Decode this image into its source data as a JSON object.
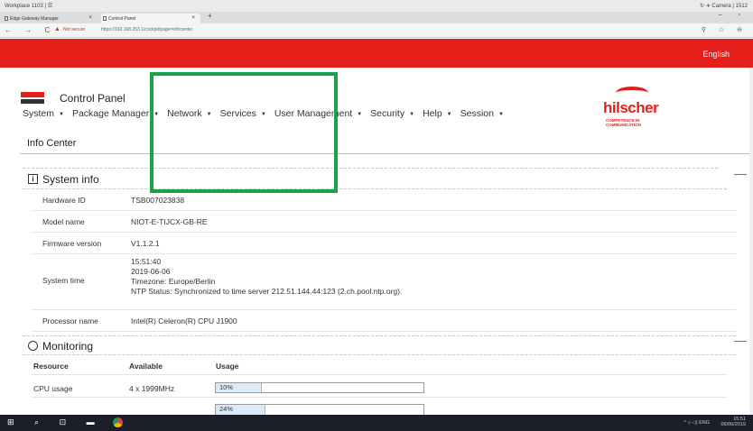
{
  "os": {
    "title_left": "Workplace 1103  |  ☰",
    "title_right": "↻  ∗ Camera  | 1512"
  },
  "browser": {
    "tabs": [
      {
        "label": "Edge Gateway Manager",
        "close": "×"
      },
      {
        "label": "Control Panel",
        "close": "×"
      }
    ],
    "new_tab": "+",
    "window_controls": "–  ▫",
    "nav": "←  →  C",
    "not_secure": "Not secure",
    "url": "https://192.168.253.1/cockpit/page=infocenter",
    "addr_icons": "⚲  ☆  ⊖"
  },
  "banner": {
    "language": "English"
  },
  "header": {
    "logo_text": "hilscher",
    "title": "Control Panel",
    "menu": [
      {
        "label": "System"
      },
      {
        "label": "Package Manager"
      },
      {
        "label": "Network"
      },
      {
        "label": "Services"
      },
      {
        "label": "User Management"
      },
      {
        "label": "Security"
      },
      {
        "label": "Help"
      },
      {
        "label": "Session"
      }
    ],
    "brand_name": "hilscher",
    "brand_tagline": "COMPETENCE IN COMMUNICATION"
  },
  "page": {
    "title": "Info Center"
  },
  "system_info": {
    "title": "System info",
    "icon": "info-icon",
    "rows": {
      "hardware_id": {
        "key": "Hardware ID",
        "value": "TSB007023838"
      },
      "model_name": {
        "key": "Model name",
        "value": "NIOT-E-TIJCX-GB-RE"
      },
      "firmware": {
        "key": "Firmware version",
        "value": "V1.1.2.1"
      },
      "system_time": {
        "key": "System time",
        "time": "15:51:40",
        "date": "2019-06-06",
        "timezone": "Timezone: Europe/Berlin",
        "ntp": "NTP Status: Synchronized to time server 212.51.144.44:123 (2.ch.pool.ntp.org)."
      },
      "processor": {
        "key": "Processor name",
        "value": "Intel(R) Celeron(R) CPU J1900"
      }
    }
  },
  "monitoring": {
    "title": "Monitoring",
    "icon": "clock-icon",
    "columns": [
      "Resource",
      "Available",
      "Usage"
    ],
    "cpu": {
      "resource": "CPU usage",
      "available": "4 x 1999MHz",
      "usage_pct": 10,
      "usage_label": "10%"
    },
    "mem_partial_label": "24%"
  },
  "taskbar": {
    "icons": "⊞ ⌕ ⊡ ▬ ▣",
    "tray_status": "^ ⌂ ◁) ENG",
    "time": "15:51",
    "date": "06/06/2019"
  },
  "colors": {
    "brand_red": "#e5201a",
    "highlight": "#1aa14a",
    "usage_fill": "#dcebf7"
  }
}
